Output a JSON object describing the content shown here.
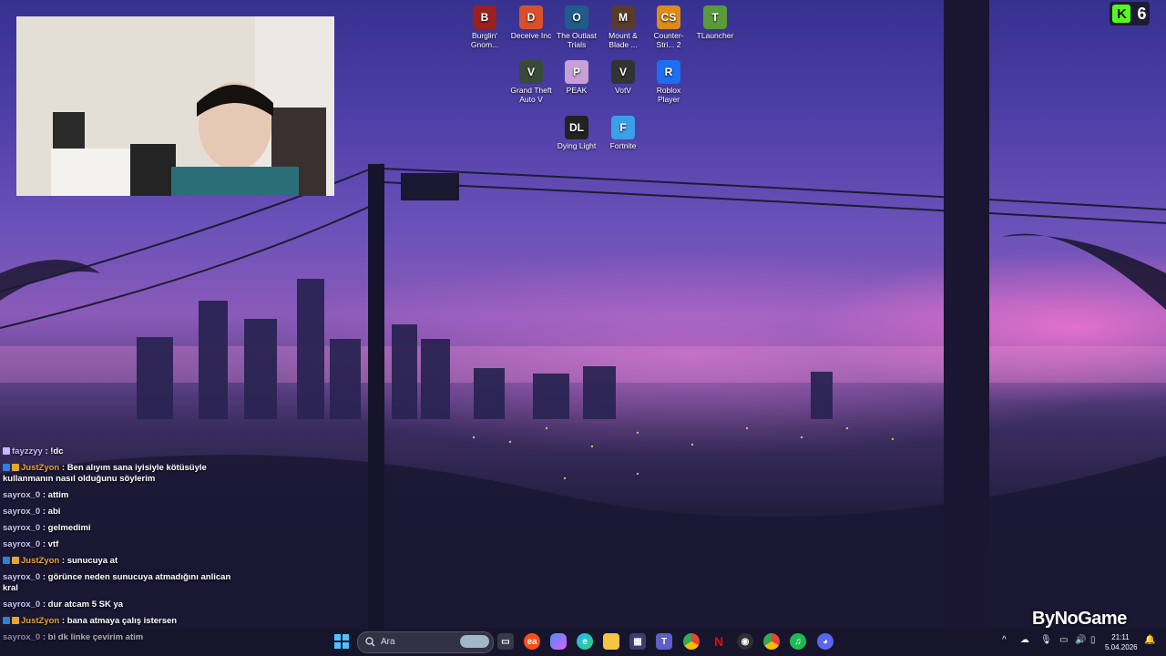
{
  "desktop": {
    "icons": [
      {
        "name": "burglin-gnomes-icon",
        "label": "Burglin' Gnom...",
        "color": "#9b2020",
        "glyph": "B"
      },
      {
        "name": "deceive-inc-icon",
        "label": "Deceive Inc",
        "color": "#d8502a",
        "glyph": "D"
      },
      {
        "name": "outlast-trials-icon",
        "label": "The Outlast Trials",
        "color": "#1f5c8a",
        "glyph": "O"
      },
      {
        "name": "mount-blade-icon",
        "label": "Mount & Blade ...",
        "color": "#5a3a2a",
        "glyph": "M"
      },
      {
        "name": "counter-strike-icon",
        "label": "Counter-Stri... 2",
        "color": "#e08a1a",
        "glyph": "CS"
      },
      {
        "name": "tlauncher-icon",
        "label": "TLauncher",
        "color": "#5a9a3a",
        "glyph": "T"
      },
      {
        "name": "gta-v-icon",
        "label": "Grand Theft Auto V",
        "color": "#3a4a3a",
        "glyph": "V"
      },
      {
        "name": "peak-icon",
        "label": "PEAK",
        "color": "#c8a0d8",
        "glyph": "P"
      },
      {
        "name": "votv-icon",
        "label": "VotV",
        "color": "#333333",
        "glyph": "V"
      },
      {
        "name": "roblox-player-icon",
        "label": "Roblox Player",
        "color": "#1c6ef2",
        "glyph": "R"
      },
      {
        "name": "dying-light-icon",
        "label": "Dying Light",
        "color": "#222222",
        "glyph": "DL"
      },
      {
        "name": "fortnite-icon",
        "label": "Fortnite",
        "color": "#3aa0e8",
        "glyph": "F"
      }
    ]
  },
  "kick": {
    "count": "6",
    "logo": "K"
  },
  "chat": [
    {
      "user": "fayzzyy",
      "text": "!dc",
      "style": "f"
    },
    {
      "user": "JustZyon",
      "text": "Ben alıyım sana iyisiyle kötüsüyle kullanmanın nasıl olduğunu söylerim",
      "style": "j"
    },
    {
      "user": "sayrox_0",
      "text": "attim",
      "style": "s"
    },
    {
      "user": "sayrox_0",
      "text": "abi",
      "style": "s"
    },
    {
      "user": "sayrox_0",
      "text": "gelmedimi",
      "style": "s"
    },
    {
      "user": "sayrox_0",
      "text": "vtf",
      "style": "s"
    },
    {
      "user": "JustZyon",
      "text": "sunucuya at",
      "style": "j"
    },
    {
      "user": "sayrox_0",
      "text": "görünce neden sunucuya atmadığını anlican kral",
      "style": "s"
    },
    {
      "user": "sayrox_0",
      "text": "dur atcam 5 SK ya",
      "style": "s"
    },
    {
      "user": "JustZyon",
      "text": "bana atmaya çalış istersen",
      "style": "j"
    },
    {
      "user": "sayrox_0",
      "text": "bi dk linke çevirim atim",
      "style": "s"
    }
  ],
  "taskbar": {
    "search_placeholder": "Ara",
    "icons": [
      "windows-start-icon",
      "search-icon",
      "task-view-icon",
      "ea-app-icon",
      "copilot-icon",
      "edge-icon",
      "file-explorer-icon",
      "microsoft-store-icon",
      "teams-icon",
      "chrome-icon",
      "netflix-icon",
      "obs-icon",
      "chrome-profile-icon",
      "spotify-icon",
      "discord-icon"
    ]
  },
  "branding": {
    "text": "ByNoGame"
  },
  "clock": {
    "time": "21:11",
    "date": "5.04.2026"
  }
}
